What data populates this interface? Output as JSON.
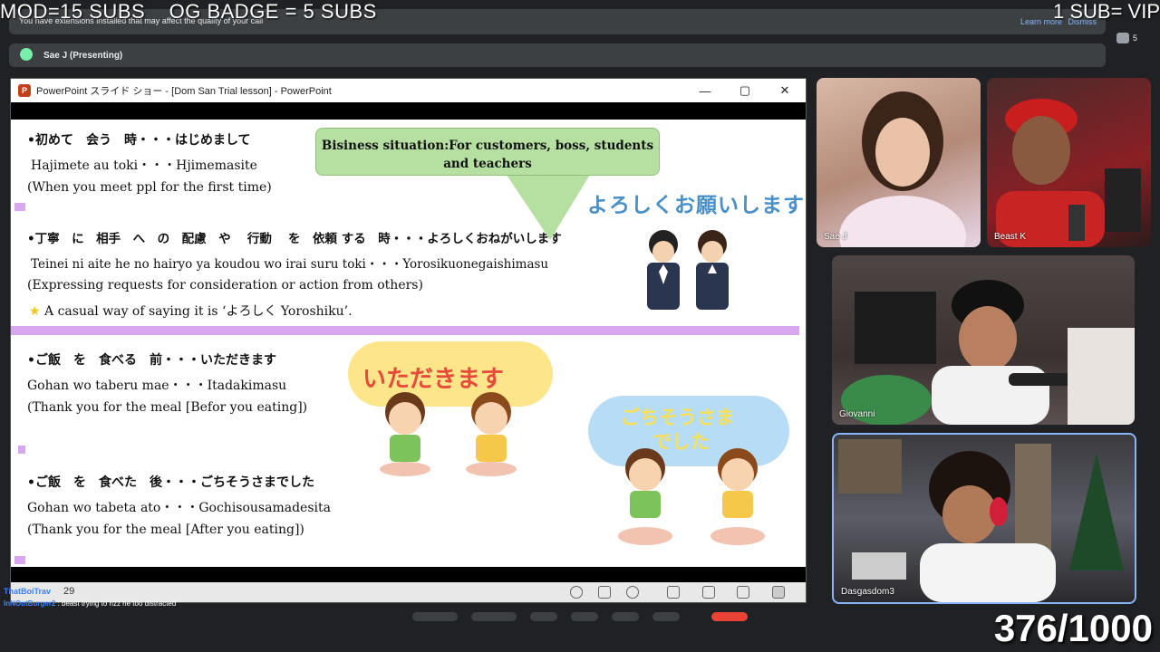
{
  "overlay": {
    "left": "MOD=15 SUBS    OG BADGE = 5 SUBS",
    "right": "1 SUB= VIP"
  },
  "meet": {
    "extension_msg": "You have extensions installed that may affect the quality of your call",
    "learn_more": "Learn more",
    "dismiss": "Dismiss",
    "people_count": "5",
    "presenting_label": "Sae J (Presenting)"
  },
  "ppt": {
    "window_title": "PowerPoint スライド ショー - [Dom San Trial lesson] - PowerPoint",
    "page_indicator": "29",
    "slide": {
      "l1_jp": "•初めて　会う　時・・・はじめまして",
      "l1_romaji": "Hajimete au  toki・・・Hjimemasite",
      "l1_en": "(When you meet ppl for the first time)",
      "l2_jp": "•丁寧　に　相手　へ　の　配慮　や　 行動　 を　依頼 する　時・・・よろしくおねがいします",
      "l2_romaji": "Teinei ni  aite   he  no  hairyo ya koudou wo  irai  suru toki・・・Yorosikuonegaishimasu",
      "l2_en": "(Expressing requests for consideration or action from others)",
      "l2_note": "A casual way of saying it is ‘よろしく Yoroshiku’.",
      "l3_jp": "•ご飯　を　食べる　前・・・いただきます",
      "l3_romaji": "Gohan wo taberu mae・・・Itadakimasu",
      "l3_en": "(Thank you for the meal [Befor you eating])",
      "l4_jp": "•ご飯　を　食べた　後・・・ごちそうさまでした",
      "l4_romaji": "Gohan wo tabeta  ato・・・Gochisousamadesita",
      "l4_en": "(Thank you for the meal [After you eating])",
      "bubble": "Bisiness situation:For customers, boss, students and teachers",
      "yoroshiku_art": "よろしくお願いします",
      "itadakimasu_art": "いただきます",
      "gochisou_art_1": "ごちそうさま",
      "gochisou_art_2": "でした"
    }
  },
  "participants": [
    {
      "name": "Sae J"
    },
    {
      "name": "Beast K"
    },
    {
      "name": "Giovanni"
    },
    {
      "name": "Dasgasdom3"
    }
  ],
  "chat": [
    {
      "user": "ThatBoiTrav",
      "text": ""
    },
    {
      "user": "InNOutBurger2",
      "text": ": beast trying to rizz he too distracted"
    }
  ],
  "counter": "376/1000",
  "colors": {
    "bg": "#202124",
    "slide_pink": "#d9a6f0",
    "bubble_green": "#b6dfa2",
    "accent_blue": "#8ab4f8"
  }
}
